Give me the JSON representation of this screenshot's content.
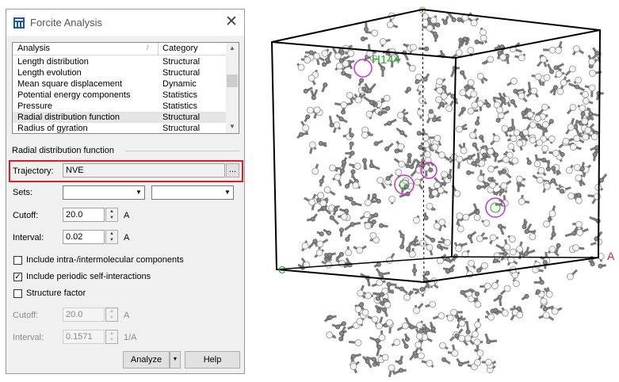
{
  "window": {
    "title": "Forcite Analysis",
    "close_glyph": "✕"
  },
  "list": {
    "headers": {
      "analysis": "Analysis",
      "category": "Category"
    },
    "rows": [
      {
        "analysis": "Length distribution",
        "category": "Structural"
      },
      {
        "analysis": "Length evolution",
        "category": "Structural"
      },
      {
        "analysis": "Mean square displacement",
        "category": "Dynamic"
      },
      {
        "analysis": "Potential energy components",
        "category": "Statistics"
      },
      {
        "analysis": "Pressure",
        "category": "Statistics"
      },
      {
        "analysis": "Radial distribution function",
        "category": "Structural"
      },
      {
        "analysis": "Radius of gyration",
        "category": "Structural"
      }
    ],
    "selected_index": 5
  },
  "section": {
    "title": "Radial distribution function"
  },
  "trajectory": {
    "label": "Trajectory:",
    "value": "NVE",
    "browse": "..."
  },
  "sets": {
    "label": "Sets:"
  },
  "cutoff": {
    "label": "Cutoff:",
    "value": "20.0",
    "unit": "A"
  },
  "interval": {
    "label": "Interval:",
    "value": "0.02",
    "unit": "A"
  },
  "options": [
    {
      "label": "Include intra-/intermolecular components",
      "checked": false
    },
    {
      "label": "Include periodic self-interactions",
      "checked": true
    },
    {
      "label": "Structure factor",
      "checked": false
    }
  ],
  "sf_cutoff": {
    "label": "Cutoff:",
    "value": "20.0",
    "unit": "A"
  },
  "sf_interval": {
    "label": "Interval:",
    "value": "0.1571",
    "unit": "1/A"
  },
  "buttons": {
    "analyze": "Analyze",
    "help": "Help"
  },
  "viewer": {
    "labels": {
      "atom": "H144",
      "origin": "C",
      "axis_a": "A"
    }
  },
  "colors": {
    "highlight": "#e02020",
    "atom_label": "#22aa22",
    "selected_atom": "#cc33cc"
  }
}
